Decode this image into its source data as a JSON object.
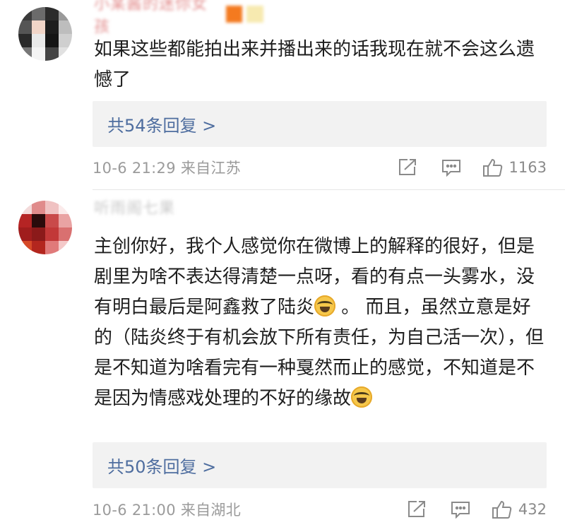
{
  "comments": [
    {
      "username": "小某酱的迷你女孩",
      "text": "如果这些都能拍出来并播出来的话我现在就不会这么遗憾了",
      "replies_label": "共54条回复 >",
      "meta": "10-6 21:29  来自江苏",
      "likes": "1163"
    },
    {
      "username": "听雨阁七果",
      "text_parts": [
        "主创你好，我个人感觉你在微博上的解释的很好，但是剧里为啥不表达得清楚一点呀，看的有点一头雾水，没有明白最后是阿鑫救了陆炎",
        " 。 而且，虽然立意是好的（陆炎终于有机会放下所有责任，为自己活一次），但是不知道为啥看完有一种戛然而止的感觉，不知道是不是因为情感戏处理的不好的缘故"
      ],
      "replies_label": "共50条回复 >",
      "meta": "10-6 21:00  来自湖北",
      "likes": "432"
    }
  ],
  "icons": {
    "share": "share-icon",
    "comment": "comment-icon",
    "like": "thumbs-up-icon",
    "emoji": "laughing-crying-emoji"
  },
  "colors": {
    "link": "#4e6d9f",
    "meta": "#9b9b9b",
    "reply_bg": "#f2f2f2"
  }
}
